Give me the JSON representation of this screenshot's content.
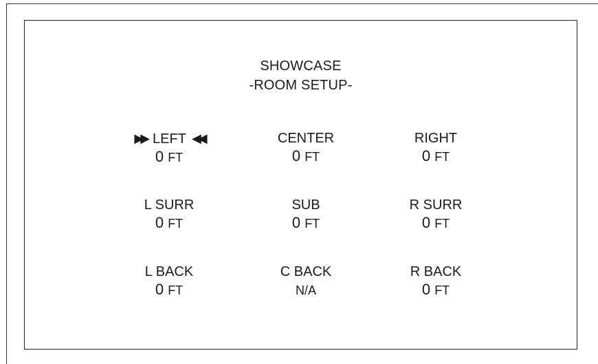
{
  "title": {
    "line1": "SHOWCASE",
    "line2": "-ROOM SETUP-"
  },
  "selection": {
    "left_marker": "▶▶",
    "right_marker": "◀◀"
  },
  "speakers": [
    {
      "label": "LEFT",
      "value": "0",
      "unit": "FT",
      "selected": true
    },
    {
      "label": "CENTER",
      "value": "0",
      "unit": "FT",
      "selected": false
    },
    {
      "label": "RIGHT",
      "value": "0",
      "unit": "FT",
      "selected": false
    },
    {
      "label": "L SURR",
      "value": "0",
      "unit": "FT",
      "selected": false
    },
    {
      "label": "SUB",
      "value": "0",
      "unit": "FT",
      "selected": false
    },
    {
      "label": "R SURR",
      "value": "0",
      "unit": "FT",
      "selected": false
    },
    {
      "label": "L BACK",
      "value": "0",
      "unit": "FT",
      "selected": false
    },
    {
      "label": "C BACK",
      "value": "N/A",
      "unit": "",
      "selected": false
    },
    {
      "label": "R BACK",
      "value": "0",
      "unit": "FT",
      "selected": false
    }
  ]
}
